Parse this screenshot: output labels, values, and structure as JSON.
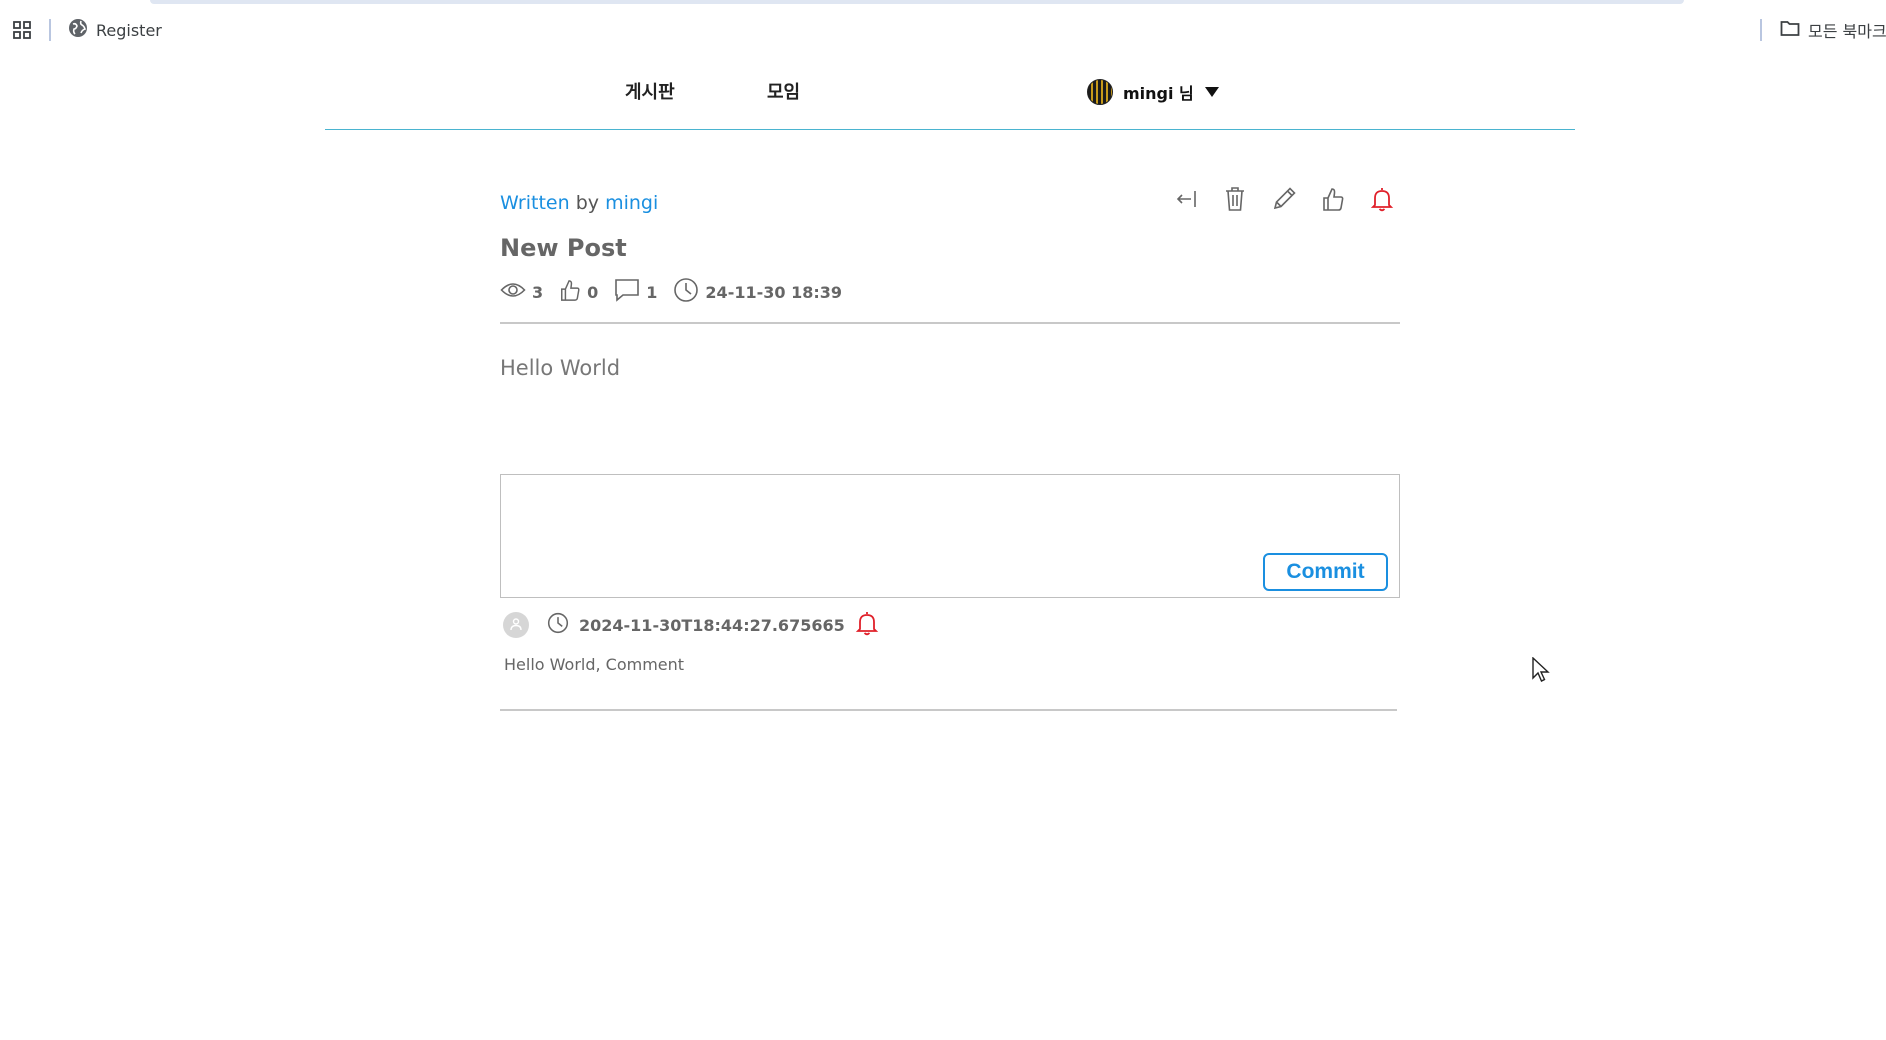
{
  "bookmarks": {
    "register_label": "Register",
    "all_bookmarks_label": "모든 북마크"
  },
  "nav": {
    "board_label": "게시판",
    "meeting_label": "모임",
    "user_label": "mingi 님"
  },
  "post": {
    "written_label": "Written",
    "by_label": "by",
    "author": "mingi",
    "title": "New Post",
    "views": "3",
    "likes": "0",
    "comments": "1",
    "date": "24-11-30 18:39",
    "body": "Hello World"
  },
  "comment_form": {
    "placeholder": "",
    "commit_label": "Commit"
  },
  "comments": [
    {
      "timestamp": "2024-11-30T18:44:27.675665",
      "text": "Hello World, Comment"
    }
  ],
  "colors": {
    "accent_blue": "#1a8fe0",
    "header_line": "#4ab4d0",
    "bell_red": "#e0202a"
  }
}
